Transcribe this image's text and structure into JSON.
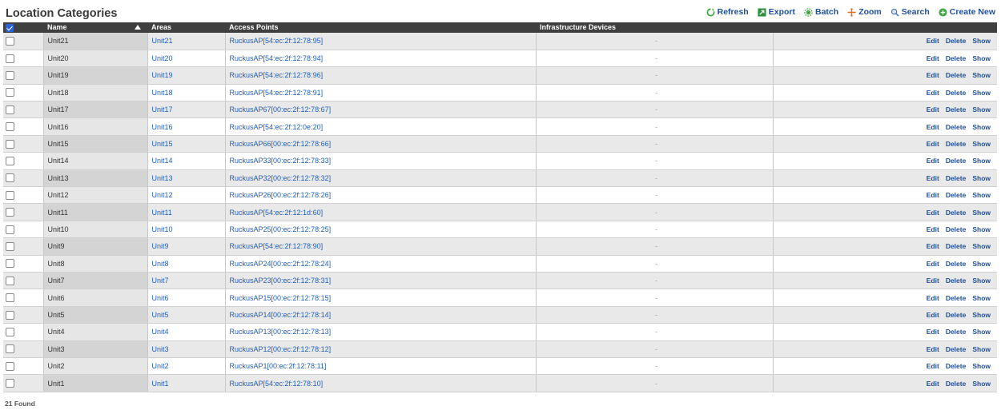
{
  "page": {
    "title": "Location Categories",
    "found_text": "21 Found"
  },
  "toolbar": [
    {
      "key": "refresh",
      "label": "Refresh",
      "icon": "refresh-icon"
    },
    {
      "key": "export",
      "label": "Export",
      "icon": "export-icon"
    },
    {
      "key": "batch",
      "label": "Batch",
      "icon": "batch-icon"
    },
    {
      "key": "zoom",
      "label": "Zoom",
      "icon": "zoom-icon"
    },
    {
      "key": "search",
      "label": "Search",
      "icon": "search-icon"
    },
    {
      "key": "create",
      "label": "Create New",
      "icon": "create-new-icon"
    }
  ],
  "table": {
    "columns": {
      "name": "Name",
      "areas": "Areas",
      "access_points": "Access Points",
      "infrastructure": "Infrastructure Devices",
      "actions": ""
    },
    "action_labels": {
      "edit": "Edit",
      "delete": "Delete",
      "show": "Show"
    },
    "rows": [
      {
        "name": "Unit21",
        "area": "Unit21",
        "ap": "RuckusAP[54:ec:2f:12:78:95]",
        "infra": "-"
      },
      {
        "name": "Unit20",
        "area": "Unit20",
        "ap": "RuckusAP[54:ec:2f:12:78:94]",
        "infra": "-"
      },
      {
        "name": "Unit19",
        "area": "Unit19",
        "ap": "RuckusAP[54:ec:2f:12:78:96]",
        "infra": "-"
      },
      {
        "name": "Unit18",
        "area": "Unit18",
        "ap": "RuckusAP[54:ec:2f:12:78:91]",
        "infra": "-"
      },
      {
        "name": "Unit17",
        "area": "Unit17",
        "ap": "RuckusAP67[00:ec:2f:12:78:67]",
        "infra": "-"
      },
      {
        "name": "Unit16",
        "area": "Unit16",
        "ap": "RuckusAP[54:ec:2f:12:0e:20]",
        "infra": "-"
      },
      {
        "name": "Unit15",
        "area": "Unit15",
        "ap": "RuckusAP66[00:ec:2f:12:78:66]",
        "infra": "-"
      },
      {
        "name": "Unit14",
        "area": "Unit14",
        "ap": "RuckusAP33[00:ec:2f:12:78:33]",
        "infra": "-"
      },
      {
        "name": "Unit13",
        "area": "Unit13",
        "ap": "RuckusAP32[00:ec:2f:12:78:32]",
        "infra": "-"
      },
      {
        "name": "Unit12",
        "area": "Unit12",
        "ap": "RuckusAP26[00:ec:2f:12:78:26]",
        "infra": "-"
      },
      {
        "name": "Unit11",
        "area": "Unit11",
        "ap": "RuckusAP[54:ec:2f:12:1d:60]",
        "infra": "-"
      },
      {
        "name": "Unit10",
        "area": "Unit10",
        "ap": "RuckusAP25[00:ec:2f:12:78:25]",
        "infra": "-"
      },
      {
        "name": "Unit9",
        "area": "Unit9",
        "ap": "RuckusAP[54:ec:2f:12:78:90]",
        "infra": "-"
      },
      {
        "name": "Unit8",
        "area": "Unit8",
        "ap": "RuckusAP24[00:ec:2f:12:78:24]",
        "infra": "-"
      },
      {
        "name": "Unit7",
        "area": "Unit7",
        "ap": "RuckusAP23[00:ec:2f:12:78:31]",
        "infra": "-"
      },
      {
        "name": "Unit6",
        "area": "Unit6",
        "ap": "RuckusAP15[00:ec:2f:12:78:15]",
        "infra": "-"
      },
      {
        "name": "Unit5",
        "area": "Unit5",
        "ap": "RuckusAP14[00:ec:2f:12:78:14]",
        "infra": "-"
      },
      {
        "name": "Unit4",
        "area": "Unit4",
        "ap": "RuckusAP13[00:ec:2f:12:78:13]",
        "infra": "-"
      },
      {
        "name": "Unit3",
        "area": "Unit3",
        "ap": "RuckusAP12[00:ec:2f:12:78:12]",
        "infra": "-"
      },
      {
        "name": "Unit2",
        "area": "Unit2",
        "ap": "RuckusAP1[00:ec:2f:12:78:11]",
        "infra": "-"
      },
      {
        "name": "Unit1",
        "area": "Unit1",
        "ap": "RuckusAP[54:ec:2f:12:78:10]",
        "infra": "-"
      }
    ]
  },
  "colors": {
    "header_bg": "#3f3f3f",
    "link": "#1f5fbf",
    "action": "#1d4f9c",
    "row_odd": "#e9e9e9",
    "row_even": "#ffffff"
  }
}
